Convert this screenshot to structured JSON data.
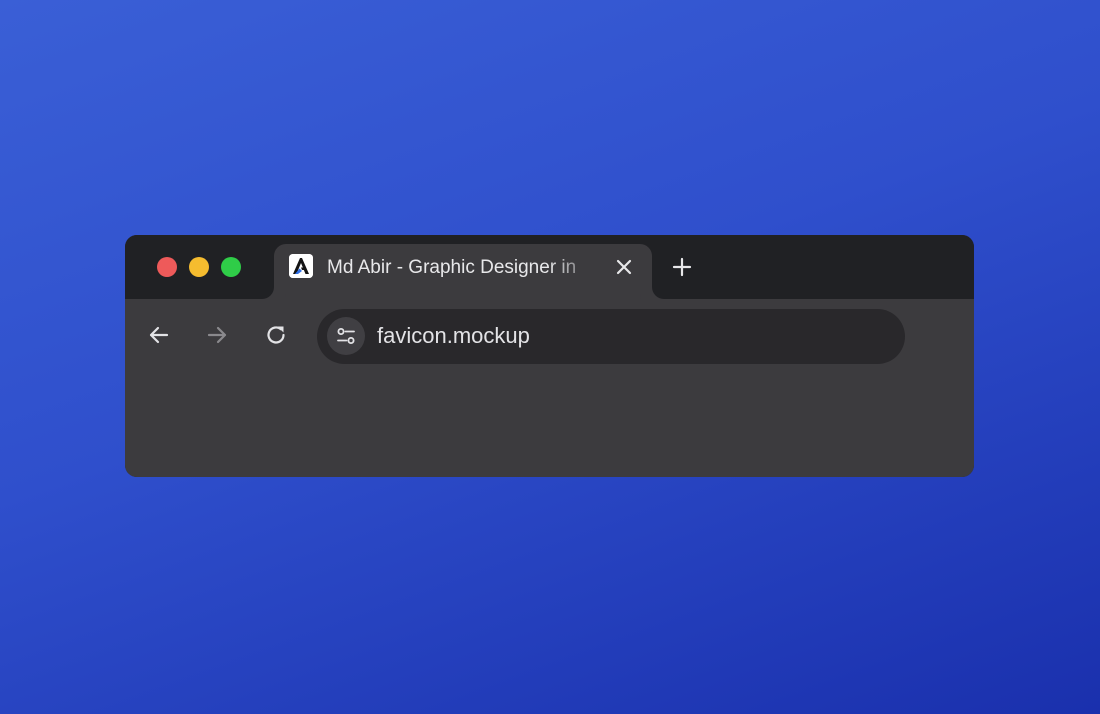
{
  "window": {
    "traffic_lights": {
      "close_color": "#ee5a5a",
      "minimize_color": "#f5bc2f",
      "maximize_color": "#2fcd48"
    }
  },
  "tab": {
    "title": "Md Abir - Graphic Designer in",
    "favicon_icon": "abir-logo-icon",
    "close_icon": "close-icon"
  },
  "new_tab": {
    "icon": "plus-icon"
  },
  "toolbar": {
    "back_icon": "arrow-left-icon",
    "forward_icon": "arrow-right-icon",
    "reload_icon": "reload-icon",
    "site_info_icon": "tune-icon"
  },
  "omnibox": {
    "url": "favicon.mockup"
  },
  "colors": {
    "frame": "#202124",
    "toolbar": "#3c3b3e",
    "omnibox": "#29282b",
    "text": "#e3e3e6",
    "background_top": "#3a5fd6",
    "background_bottom": "#1a30ad"
  }
}
